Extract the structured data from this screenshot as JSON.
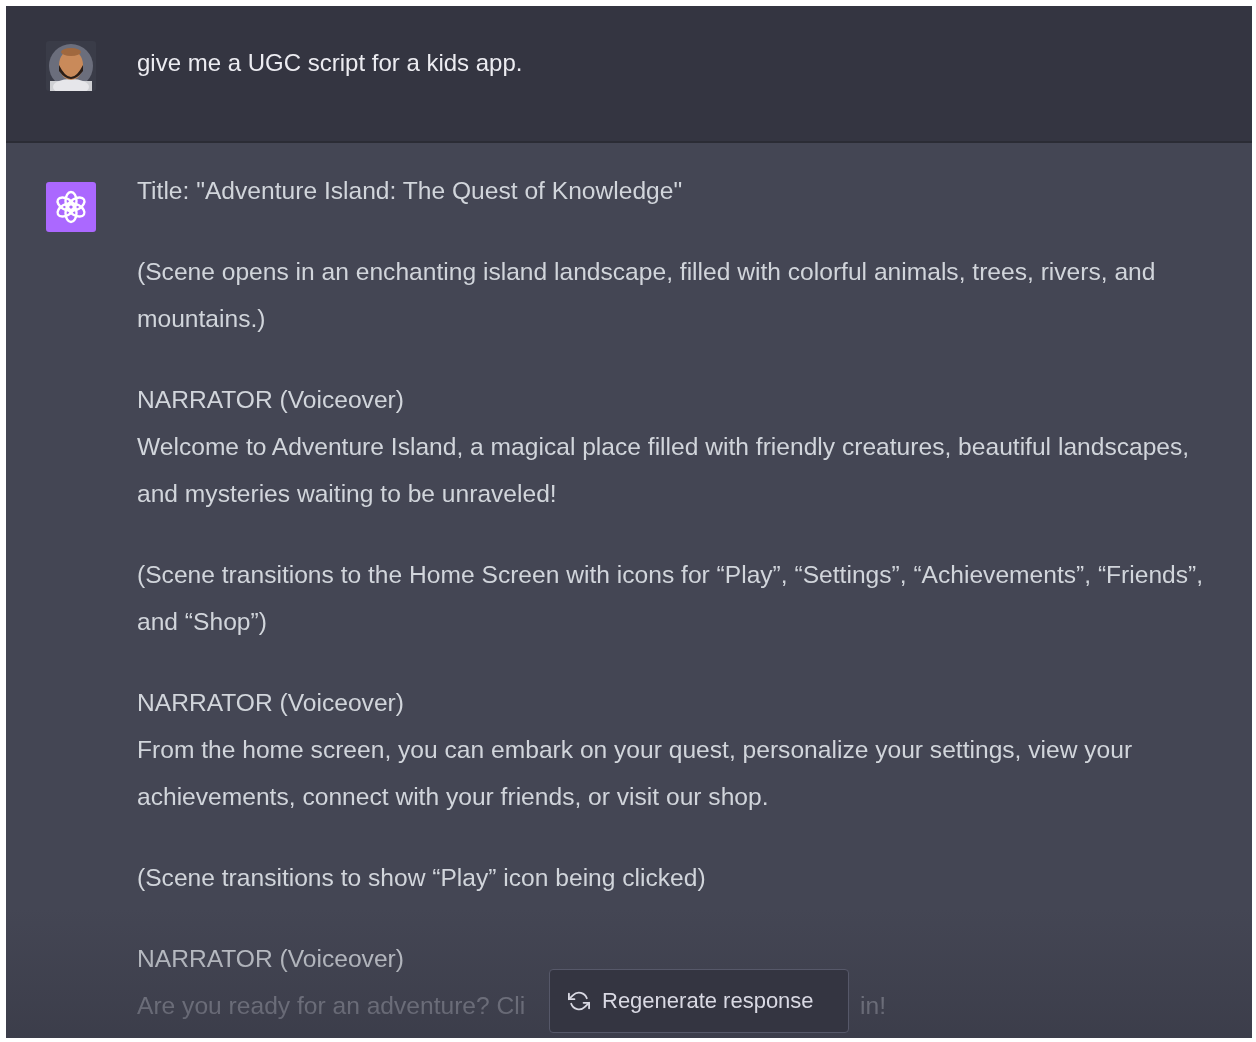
{
  "user_message": {
    "text": "give me a UGC script for a kids app."
  },
  "assistant_message": {
    "paragraphs": [
      {
        "kind": "text",
        "text": "Title: \"Adventure Island: The Quest of Knowledge\""
      },
      {
        "kind": "text",
        "text": "(Scene opens in an enchanting island landscape, filled with colorful animals, trees, rivers, and mountains.)"
      },
      {
        "kind": "speech",
        "speaker": "NARRATOR (Voiceover)",
        "text": "Welcome to Adventure Island, a magical place filled with friendly creatures, beautiful landscapes, and mysteries waiting to be unraveled!"
      },
      {
        "kind": "text",
        "text": "(Scene transitions to the Home Screen with icons for “Play”, “Settings”, “Achievements”, “Friends”, and “Shop”)"
      },
      {
        "kind": "speech",
        "speaker": "NARRATOR (Voiceover)",
        "text": "From the home screen, you can embark on your quest, personalize your settings, view your achievements, connect with your friends, or visit our shop."
      },
      {
        "kind": "text",
        "text": "(Scene transitions to show “Play” icon being clicked)"
      },
      {
        "kind": "speech",
        "speaker": "NARRATOR (Voiceover)",
        "text_parts": [
          "Are you ready for an adventure? Cli",
          "in!"
        ]
      }
    ]
  },
  "regenerate_button": {
    "label": "Regenerate response"
  }
}
